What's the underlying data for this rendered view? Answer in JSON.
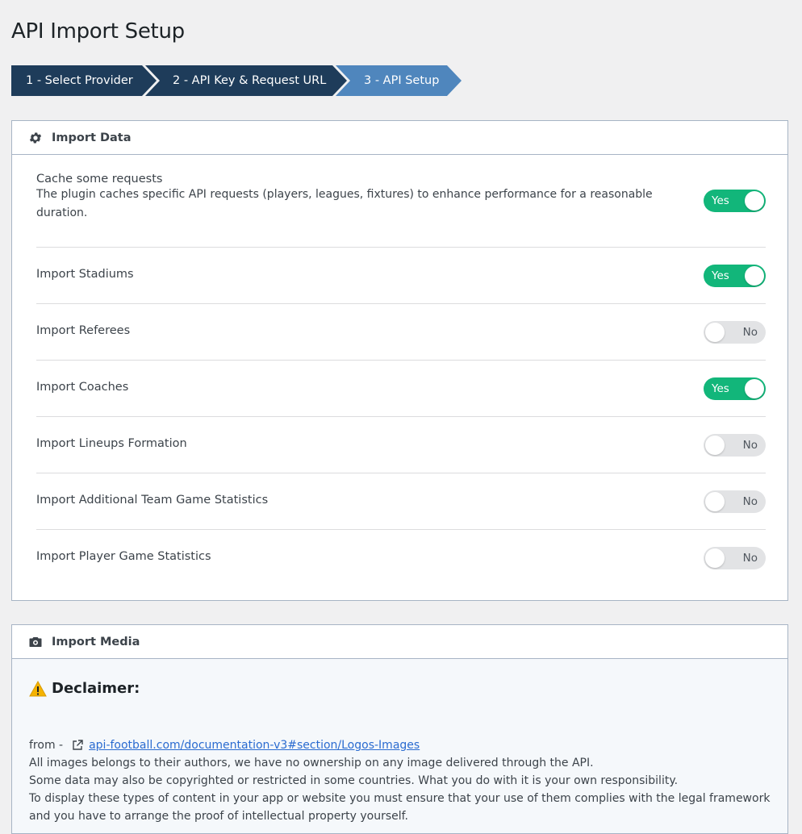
{
  "page": {
    "title": "API Import Setup"
  },
  "wizard": {
    "steps": [
      {
        "label": "1 - Select Provider"
      },
      {
        "label": "2 - API Key & Request URL"
      },
      {
        "label": "3 - API Setup"
      }
    ],
    "colors": {
      "done": "#1e3c5a",
      "active": "#4f86bd"
    }
  },
  "import_data": {
    "title": "Import Data",
    "icon": "gear-icon",
    "settings": [
      {
        "label": "Cache some requests",
        "description": "The plugin caches specific API requests (players, leagues, fixtures) to enhance performance for a reasonable duration.",
        "value": "Yes",
        "on": true
      },
      {
        "label": "Import Stadiums",
        "value": "Yes",
        "on": true
      },
      {
        "label": "Import Referees",
        "value": "No",
        "on": false
      },
      {
        "label": "Import Coaches",
        "value": "Yes",
        "on": true
      },
      {
        "label": "Import Lineups Formation",
        "value": "No",
        "on": false
      },
      {
        "label": "Import Additional Team Game Statistics",
        "value": "No",
        "on": false
      },
      {
        "label": "Import Player Game Statistics",
        "value": "No",
        "on": false
      }
    ]
  },
  "import_media": {
    "title": "Import Media",
    "icon": "camera-icon",
    "disclaimer": {
      "icon": "warning-icon",
      "title": "Declaimer:",
      "from_label": "from -",
      "link_icon": "external-link-icon",
      "link_text": "api-football.com/documentation-v3#section/Logos-Images",
      "lines": [
        "All images belongs to their authors, we have no ownership on any image delivered through the API.",
        "Some data may also be copyrighted or restricted in some countries. What you do with it is your own responsibility.",
        "To display these types of content in your app or website you must ensure that your use of them complies with the legal framework",
        "and you have to arrange the proof of intellectual property yourself."
      ]
    }
  },
  "colors": {
    "toggle_on": "#12b67a",
    "toggle_off": "#e2e3e5",
    "link": "#2a6bd0"
  }
}
